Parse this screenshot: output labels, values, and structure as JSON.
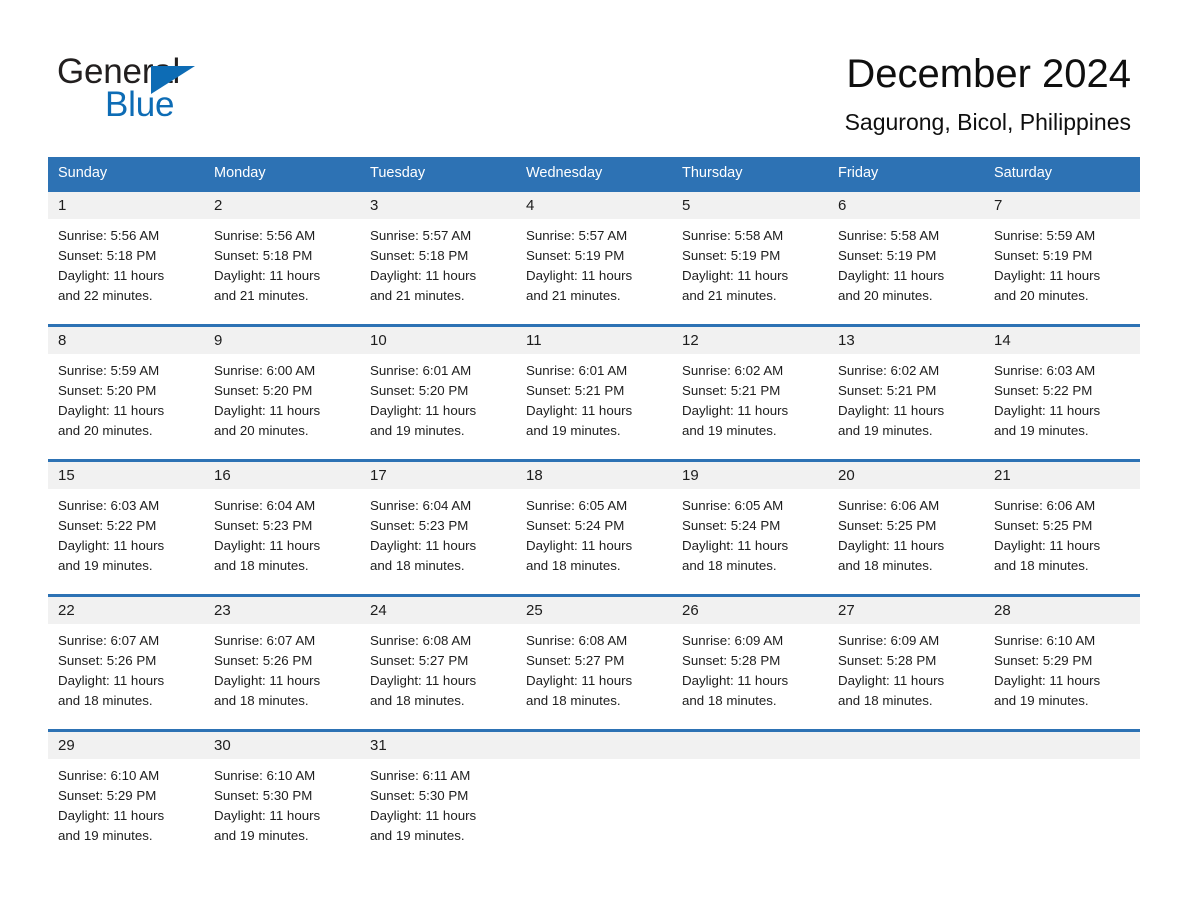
{
  "brand": {
    "line1": "General",
    "line2": "Blue",
    "triangle_icon": "triangle-icon",
    "accent_color": "#0d6cb5"
  },
  "header": {
    "title": "December 2024",
    "subtitle": "Sagurong, Bicol, Philippines"
  },
  "colors": {
    "header_blue": "#2d72b4",
    "band_gray": "#f1f1f1",
    "text": "#1d1d1d"
  },
  "weekdays": [
    "Sunday",
    "Monday",
    "Tuesday",
    "Wednesday",
    "Thursday",
    "Friday",
    "Saturday"
  ],
  "weeks": [
    [
      {
        "day": "1",
        "sunrise": "Sunrise: 5:56 AM",
        "sunset": "Sunset: 5:18 PM",
        "daylight1": "Daylight: 11 hours",
        "daylight2": "and 22 minutes."
      },
      {
        "day": "2",
        "sunrise": "Sunrise: 5:56 AM",
        "sunset": "Sunset: 5:18 PM",
        "daylight1": "Daylight: 11 hours",
        "daylight2": "and 21 minutes."
      },
      {
        "day": "3",
        "sunrise": "Sunrise: 5:57 AM",
        "sunset": "Sunset: 5:18 PM",
        "daylight1": "Daylight: 11 hours",
        "daylight2": "and 21 minutes."
      },
      {
        "day": "4",
        "sunrise": "Sunrise: 5:57 AM",
        "sunset": "Sunset: 5:19 PM",
        "daylight1": "Daylight: 11 hours",
        "daylight2": "and 21 minutes."
      },
      {
        "day": "5",
        "sunrise": "Sunrise: 5:58 AM",
        "sunset": "Sunset: 5:19 PM",
        "daylight1": "Daylight: 11 hours",
        "daylight2": "and 21 minutes."
      },
      {
        "day": "6",
        "sunrise": "Sunrise: 5:58 AM",
        "sunset": "Sunset: 5:19 PM",
        "daylight1": "Daylight: 11 hours",
        "daylight2": "and 20 minutes."
      },
      {
        "day": "7",
        "sunrise": "Sunrise: 5:59 AM",
        "sunset": "Sunset: 5:19 PM",
        "daylight1": "Daylight: 11 hours",
        "daylight2": "and 20 minutes."
      }
    ],
    [
      {
        "day": "8",
        "sunrise": "Sunrise: 5:59 AM",
        "sunset": "Sunset: 5:20 PM",
        "daylight1": "Daylight: 11 hours",
        "daylight2": "and 20 minutes."
      },
      {
        "day": "9",
        "sunrise": "Sunrise: 6:00 AM",
        "sunset": "Sunset: 5:20 PM",
        "daylight1": "Daylight: 11 hours",
        "daylight2": "and 20 minutes."
      },
      {
        "day": "10",
        "sunrise": "Sunrise: 6:01 AM",
        "sunset": "Sunset: 5:20 PM",
        "daylight1": "Daylight: 11 hours",
        "daylight2": "and 19 minutes."
      },
      {
        "day": "11",
        "sunrise": "Sunrise: 6:01 AM",
        "sunset": "Sunset: 5:21 PM",
        "daylight1": "Daylight: 11 hours",
        "daylight2": "and 19 minutes."
      },
      {
        "day": "12",
        "sunrise": "Sunrise: 6:02 AM",
        "sunset": "Sunset: 5:21 PM",
        "daylight1": "Daylight: 11 hours",
        "daylight2": "and 19 minutes."
      },
      {
        "day": "13",
        "sunrise": "Sunrise: 6:02 AM",
        "sunset": "Sunset: 5:21 PM",
        "daylight1": "Daylight: 11 hours",
        "daylight2": "and 19 minutes."
      },
      {
        "day": "14",
        "sunrise": "Sunrise: 6:03 AM",
        "sunset": "Sunset: 5:22 PM",
        "daylight1": "Daylight: 11 hours",
        "daylight2": "and 19 minutes."
      }
    ],
    [
      {
        "day": "15",
        "sunrise": "Sunrise: 6:03 AM",
        "sunset": "Sunset: 5:22 PM",
        "daylight1": "Daylight: 11 hours",
        "daylight2": "and 19 minutes."
      },
      {
        "day": "16",
        "sunrise": "Sunrise: 6:04 AM",
        "sunset": "Sunset: 5:23 PM",
        "daylight1": "Daylight: 11 hours",
        "daylight2": "and 18 minutes."
      },
      {
        "day": "17",
        "sunrise": "Sunrise: 6:04 AM",
        "sunset": "Sunset: 5:23 PM",
        "daylight1": "Daylight: 11 hours",
        "daylight2": "and 18 minutes."
      },
      {
        "day": "18",
        "sunrise": "Sunrise: 6:05 AM",
        "sunset": "Sunset: 5:24 PM",
        "daylight1": "Daylight: 11 hours",
        "daylight2": "and 18 minutes."
      },
      {
        "day": "19",
        "sunrise": "Sunrise: 6:05 AM",
        "sunset": "Sunset: 5:24 PM",
        "daylight1": "Daylight: 11 hours",
        "daylight2": "and 18 minutes."
      },
      {
        "day": "20",
        "sunrise": "Sunrise: 6:06 AM",
        "sunset": "Sunset: 5:25 PM",
        "daylight1": "Daylight: 11 hours",
        "daylight2": "and 18 minutes."
      },
      {
        "day": "21",
        "sunrise": "Sunrise: 6:06 AM",
        "sunset": "Sunset: 5:25 PM",
        "daylight1": "Daylight: 11 hours",
        "daylight2": "and 18 minutes."
      }
    ],
    [
      {
        "day": "22",
        "sunrise": "Sunrise: 6:07 AM",
        "sunset": "Sunset: 5:26 PM",
        "daylight1": "Daylight: 11 hours",
        "daylight2": "and 18 minutes."
      },
      {
        "day": "23",
        "sunrise": "Sunrise: 6:07 AM",
        "sunset": "Sunset: 5:26 PM",
        "daylight1": "Daylight: 11 hours",
        "daylight2": "and 18 minutes."
      },
      {
        "day": "24",
        "sunrise": "Sunrise: 6:08 AM",
        "sunset": "Sunset: 5:27 PM",
        "daylight1": "Daylight: 11 hours",
        "daylight2": "and 18 minutes."
      },
      {
        "day": "25",
        "sunrise": "Sunrise: 6:08 AM",
        "sunset": "Sunset: 5:27 PM",
        "daylight1": "Daylight: 11 hours",
        "daylight2": "and 18 minutes."
      },
      {
        "day": "26",
        "sunrise": "Sunrise: 6:09 AM",
        "sunset": "Sunset: 5:28 PM",
        "daylight1": "Daylight: 11 hours",
        "daylight2": "and 18 minutes."
      },
      {
        "day": "27",
        "sunrise": "Sunrise: 6:09 AM",
        "sunset": "Sunset: 5:28 PM",
        "daylight1": "Daylight: 11 hours",
        "daylight2": "and 18 minutes."
      },
      {
        "day": "28",
        "sunrise": "Sunrise: 6:10 AM",
        "sunset": "Sunset: 5:29 PM",
        "daylight1": "Daylight: 11 hours",
        "daylight2": "and 19 minutes."
      }
    ],
    [
      {
        "day": "29",
        "sunrise": "Sunrise: 6:10 AM",
        "sunset": "Sunset: 5:29 PM",
        "daylight1": "Daylight: 11 hours",
        "daylight2": "and 19 minutes."
      },
      {
        "day": "30",
        "sunrise": "Sunrise: 6:10 AM",
        "sunset": "Sunset: 5:30 PM",
        "daylight1": "Daylight: 11 hours",
        "daylight2": "and 19 minutes."
      },
      {
        "day": "31",
        "sunrise": "Sunrise: 6:11 AM",
        "sunset": "Sunset: 5:30 PM",
        "daylight1": "Daylight: 11 hours",
        "daylight2": "and 19 minutes."
      },
      {
        "day": "",
        "sunrise": "",
        "sunset": "",
        "daylight1": "",
        "daylight2": ""
      },
      {
        "day": "",
        "sunrise": "",
        "sunset": "",
        "daylight1": "",
        "daylight2": ""
      },
      {
        "day": "",
        "sunrise": "",
        "sunset": "",
        "daylight1": "",
        "daylight2": ""
      },
      {
        "day": "",
        "sunrise": "",
        "sunset": "",
        "daylight1": "",
        "daylight2": ""
      }
    ]
  ]
}
